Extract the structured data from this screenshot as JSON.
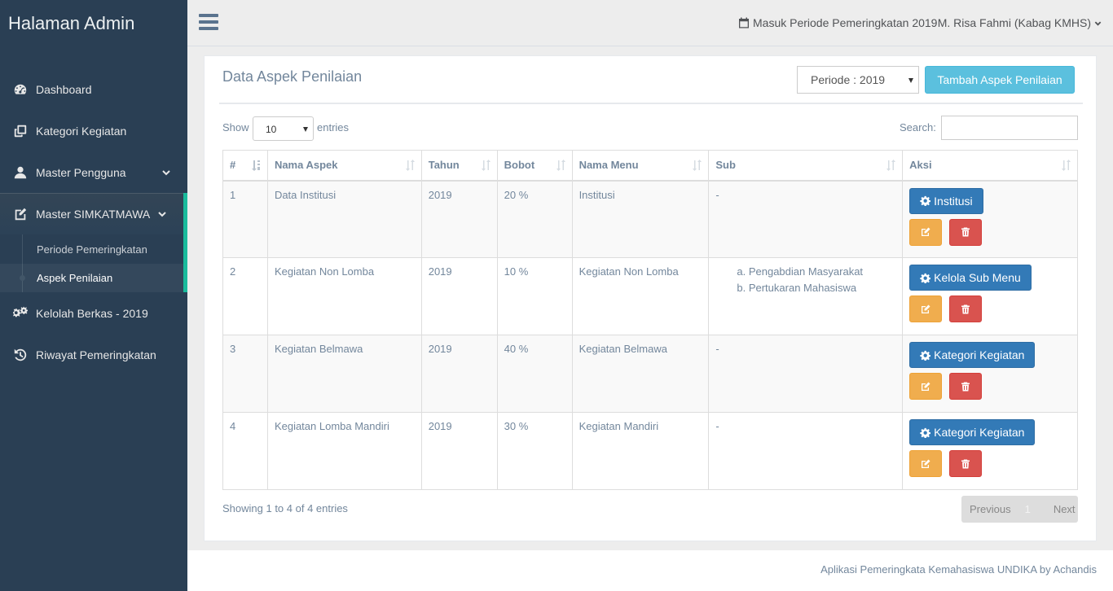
{
  "sidebar": {
    "brand": "Halaman Admin",
    "items": [
      {
        "label": "Dashboard"
      },
      {
        "label": "Kategori Kegiatan"
      },
      {
        "label": "Master Pengguna"
      },
      {
        "label": "Master SIMKATMAWA"
      },
      {
        "label": "Kelolah Berkas - 2019"
      },
      {
        "label": "Riwayat Pemeringkatan"
      }
    ],
    "subitems": [
      {
        "label": "Periode Pemeringkatan"
      },
      {
        "label": "Aspek Penilaian"
      }
    ]
  },
  "topnav": {
    "periode_info": "Masuk Periode Pemeringkatan 2019",
    "user": "M. Risa Fahmi (Kabag KMHS)"
  },
  "panel": {
    "title": "Data Aspek Penilaian",
    "periode_select": "Periode : 2019",
    "add_button": "Tambah Aspek Penilaian",
    "show_label": "Show",
    "length_value": "10",
    "entries_label": "entries",
    "search_label": "Search:"
  },
  "table": {
    "headers": [
      "#",
      "Nama Aspek",
      "Tahun",
      "Bobot",
      "Nama Menu",
      "Sub",
      "Aksi"
    ],
    "rows": [
      {
        "no": "1",
        "nama": "Data Institusi",
        "tahun": "2019",
        "bobot": "20 %",
        "menu": "Institusi",
        "sub": "-",
        "subs": [],
        "action": "Institusi"
      },
      {
        "no": "2",
        "nama": "Kegiatan Non Lomba",
        "tahun": "2019",
        "bobot": "10 %",
        "menu": "Kegiatan Non Lomba",
        "sub": "",
        "subs": [
          "a. Pengabdian Masyarakat",
          "b. Pertukaran Mahasiswa"
        ],
        "action": "Kelola Sub Menu"
      },
      {
        "no": "3",
        "nama": "Kegiatan Belmawa",
        "tahun": "2019",
        "bobot": "40 %",
        "menu": "Kegiatan Belmawa",
        "sub": "-",
        "subs": [],
        "action": "Kategori Kegiatan"
      },
      {
        "no": "4",
        "nama": "Kegiatan Lomba Mandiri",
        "tahun": "2019",
        "bobot": "30 %",
        "menu": "Kegiatan Mandiri",
        "sub": "-",
        "subs": [],
        "action": "Kategori Kegiatan"
      }
    ]
  },
  "pagination": {
    "info": "Showing 1 to 4 of 4 entries",
    "previous": "Previous",
    "page": "1",
    "next": "Next"
  },
  "footer": {
    "text": "Aplikasi Pemeringkata Kemahasiswa UNDIKA by Achandis"
  },
  "icons": {
    "dashboard": "dashboard-icon",
    "kategori": "clone-icon",
    "pengguna": "user-icon",
    "simkatmawa": "edit-icon",
    "berkas": "cogs-icon",
    "riwayat": "history-icon"
  },
  "colors": {
    "sidebar": "#2A3F54",
    "accent": "#1ABB9C",
    "primary": "#337AB7",
    "info": "#5BC0DE",
    "warning": "#F0AD4E",
    "danger": "#D9534F"
  }
}
